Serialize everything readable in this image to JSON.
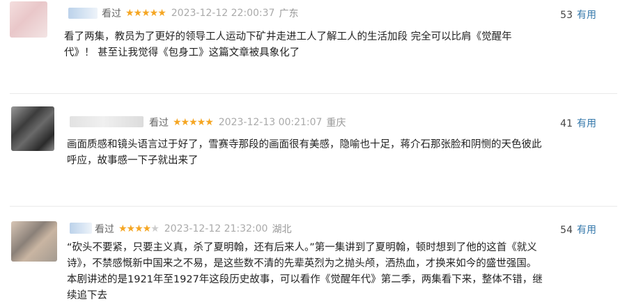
{
  "reviews": [
    {
      "status": "看过",
      "stars": "★★★★★",
      "stars_off": "",
      "time": "2023-12-12 22:00:37",
      "location": "广东",
      "useful_count": "53",
      "useful_label": "有用",
      "lines": [
        "看了两集，教员为了更好的领导工人运动下矿井走进工人了解工人的生活加段 完全可以比肩《觉醒年",
        "代》！ 甚至让我觉得《包身工》这篇文章被具象化了"
      ]
    },
    {
      "status": "看过",
      "stars": "★★★★★",
      "stars_off": "",
      "time": "2023-12-13 00:21:07",
      "location": "重庆",
      "useful_count": "41",
      "useful_label": "有用",
      "lines": [
        "画面质感和镜头语言过于好了，雪赛寺那段的画面很有美感，隐喻也十足，蒋介石那张脸和阴恻的天色彼此",
        "呼应，故事感一下子就出来了"
      ]
    },
    {
      "status": "看过",
      "stars": "★★★★",
      "stars_off": "★",
      "time": "2023-12-12 21:32:00",
      "location": "湖北",
      "useful_count": "54",
      "useful_label": "有用",
      "lines": [
        "“砍头不要紧，只要主义真，杀了夏明翰，还有后来人。”第一集讲到了夏明翰，顿时想到了他的这首《就义",
        "诗》，不禁感慨新中国来之不易，是这些数不清的先辈英烈为之抛头颅，洒热血，才换来如今的盛世强国。",
        "本剧讲述的是1921年至1927年这段历史故事，可以看作《觉醒年代》第二季，两集看下来，整体不错，继",
        "续追下去"
      ]
    }
  ]
}
